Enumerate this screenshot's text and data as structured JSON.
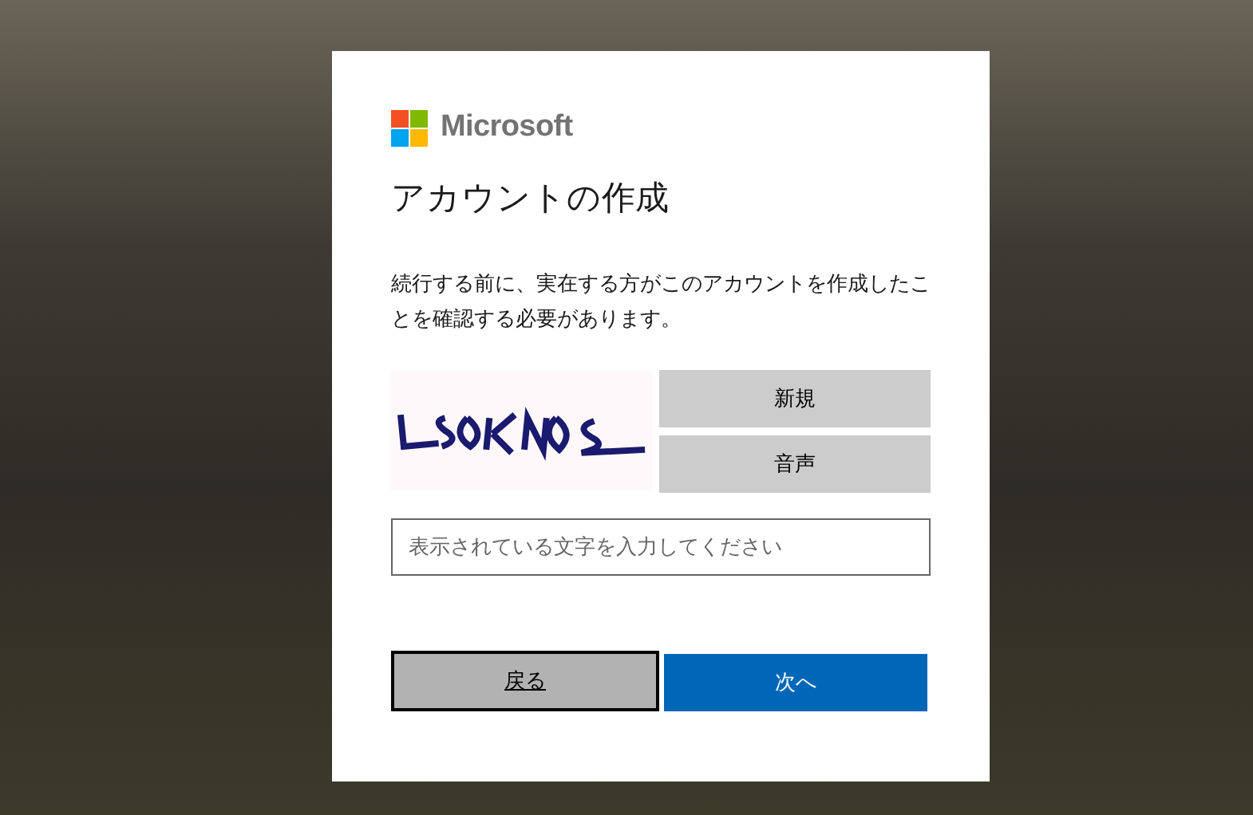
{
  "logo": {
    "text": "Microsoft"
  },
  "title": "アカウントの作成",
  "message": "続行する前に、実在する方がこのアカウントを作成したことを確認する必要があります。",
  "captcha": {
    "buttons": [
      "新規",
      "音声"
    ]
  },
  "input": {
    "placeholder": "表示されている文字を入力してください"
  },
  "buttons": [
    {
      "label": "戻る",
      "kind": "secondary"
    },
    {
      "label": "次へ",
      "kind": "primary"
    }
  ]
}
